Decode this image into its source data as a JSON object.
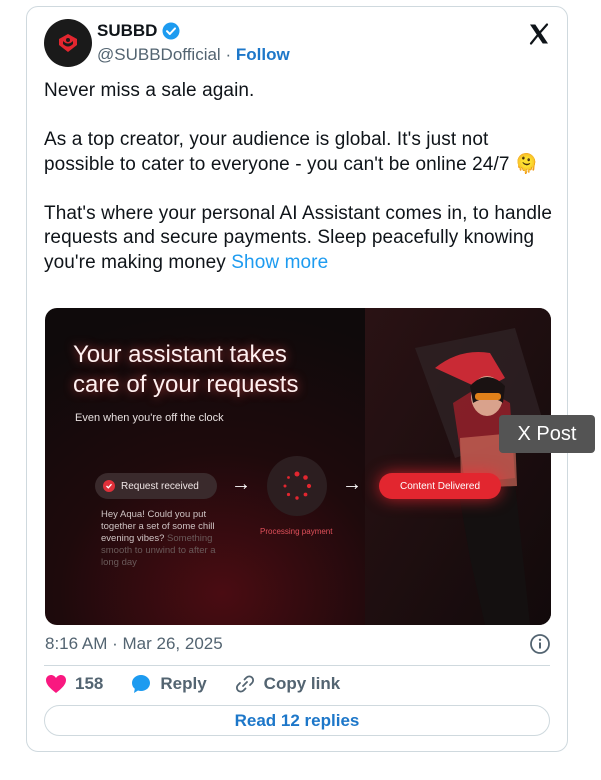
{
  "author": {
    "name": "SUBBD",
    "handle": "@SUBBDofficial",
    "separator": "·",
    "follow_label": "Follow"
  },
  "tweet": {
    "paragraphs": [
      "Never miss a sale again.",
      "As a top creator, your audience is global. It's just not possible to cater to everyone - you can't be online 24/7 🫠"
    ],
    "last_paragraph": "That's where your personal AI Assistant comes in, to handle requests and secure payments. Sleep peacefully knowing you're making money",
    "show_more": "Show more"
  },
  "media": {
    "headline_line1": "Your assistant takes",
    "headline_line2": "care of your requests",
    "subhead": "Even when you're off the clock",
    "request_label": "Request received",
    "message_visible": "Hey Aqua! Could you put together a set of some chill evening vibes?",
    "message_faded": "Something smooth to unwind to after a long day",
    "processing_label": "Processing payment",
    "delivered_label": "Content Delivered"
  },
  "tooltip": "X Post",
  "meta": {
    "time": "8:16 AM",
    "separator": "·",
    "date": "Mar 26, 2025"
  },
  "actions": {
    "like_count": "158",
    "reply_label": "Reply",
    "copy_link_label": "Copy link"
  },
  "read_replies_label": "Read 12 replies",
  "colors": {
    "accent_blue": "#1d77c9",
    "link_blue": "#1d9bf0",
    "heart_pink": "#f91880",
    "brand_red": "#e2262f"
  }
}
